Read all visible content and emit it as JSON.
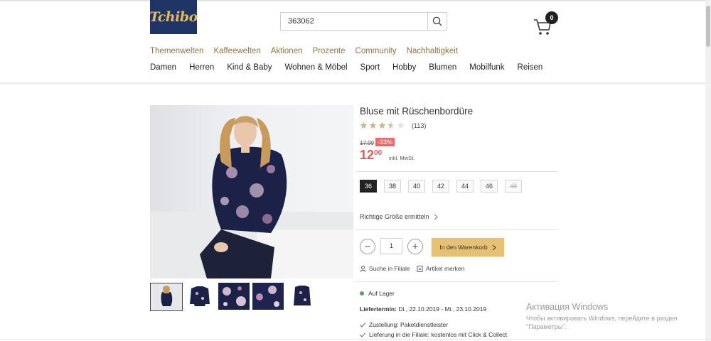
{
  "header": {
    "logo_text": "Tchibo",
    "search": {
      "value": "363062",
      "icon": "search-icon"
    },
    "cart": {
      "count": "0",
      "icon": "cart-icon"
    }
  },
  "nav": {
    "primary": [
      "Themenwelten",
      "Kaffeewelten",
      "Aktionen",
      "Prozente",
      "Community",
      "Nachhaltigkeit"
    ],
    "secondary": [
      "Damen",
      "Herren",
      "Kind & Baby",
      "Wohnen & Möbel",
      "Sport",
      "Hobby",
      "Blumen",
      "Mobilfunk",
      "Reisen"
    ]
  },
  "product": {
    "title": "Bluse mit Rüschenbordüre",
    "rating": 3.5,
    "rating_max": 5,
    "review_count": "(113)",
    "old_price": "17.99",
    "discount": "-33%",
    "price_main": "12",
    "price_cents": "00",
    "vat_note": "inkl. MwSt.",
    "sizes": [
      {
        "label": "36",
        "state": "selected"
      },
      {
        "label": "38",
        "state": "available"
      },
      {
        "label": "40",
        "state": "available"
      },
      {
        "label": "42",
        "state": "available"
      },
      {
        "label": "44",
        "state": "available"
      },
      {
        "label": "46",
        "state": "available"
      },
      {
        "label": "48",
        "state": "unavailable"
      }
    ],
    "fit_link": "Richtige Größe ermitteln",
    "quantity": "1",
    "add_to_cart": "In den Warenkorb",
    "find_in_store": "Suche in Filiale",
    "remember_item": "Artikel merken",
    "stock_status": "Auf Lager",
    "delivery_label": "Liefertermin:",
    "delivery_dates": "Di., 22.10.2019 - Mi., 23.10.2019",
    "shipping_lines": [
      "Zustellung: Paketdienstleister",
      "Lieferung in die Filiale: kostenlos mit Click & Collect"
    ],
    "accent_colors": {
      "price": "#e05a5a",
      "button": "#e6c173",
      "nav": "#8f7344",
      "logo_bg": "#1f3568"
    }
  },
  "os_overlay": {
    "title": "Активация Windows",
    "subtitle_line1": "Чтобы активировать Windows, перейдите в раздел",
    "subtitle_line2": "\"Параметры\"."
  }
}
